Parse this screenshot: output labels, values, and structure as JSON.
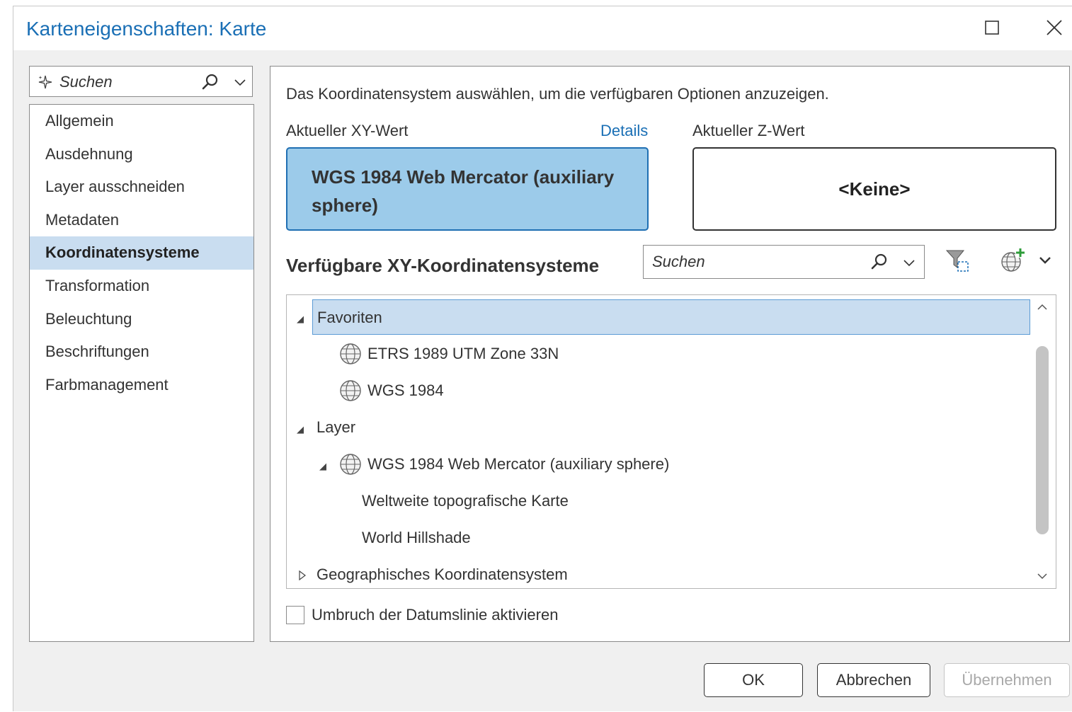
{
  "window": {
    "title": "Karteneigenschaften: Karte",
    "maximize_icon": "maximize-icon",
    "close_icon": "close-icon"
  },
  "sidebar": {
    "search_placeholder": "Suchen",
    "items": [
      {
        "label": "Allgemein"
      },
      {
        "label": "Ausdehnung"
      },
      {
        "label": "Layer ausschneiden"
      },
      {
        "label": "Metadaten"
      },
      {
        "label": "Koordinatensysteme",
        "selected": true
      },
      {
        "label": "Transformation"
      },
      {
        "label": "Beleuchtung"
      },
      {
        "label": "Beschriftungen"
      },
      {
        "label": "Farbmanagement"
      }
    ]
  },
  "main": {
    "instruction": "Das Koordinatensystem auswählen, um die verfügbaren Optionen anzuzeigen.",
    "current_xy_label": "Aktueller XY-Wert",
    "details_link": "Details",
    "current_z_label": "Aktueller Z-Wert",
    "current_xy_value": "WGS 1984 Web Mercator (auxiliary sphere)",
    "current_z_value": "<Keine>",
    "available_heading": "Verfügbare XY-Koordinatensysteme",
    "search_placeholder": "Suchen",
    "tree": {
      "favorites": "Favoriten",
      "fav_items": [
        "ETRS 1989 UTM Zone 33N",
        "WGS 1984"
      ],
      "layer": "Layer",
      "layer_cs": "WGS 1984 Web Mercator (auxiliary sphere)",
      "layer_items": [
        "Weltweite topografische Karte",
        "World Hillshade"
      ],
      "geographic": "Geographisches Koordinatensystem"
    },
    "checkbox_label": "Umbruch der Datumslinie aktivieren"
  },
  "footer": {
    "ok": "OK",
    "cancel": "Abbrechen",
    "apply": "Übernehmen"
  },
  "colors": {
    "accent": "#1a6fb5",
    "selected_bg": "#c9ddf0",
    "xy_box_bg": "#9ccbea"
  }
}
